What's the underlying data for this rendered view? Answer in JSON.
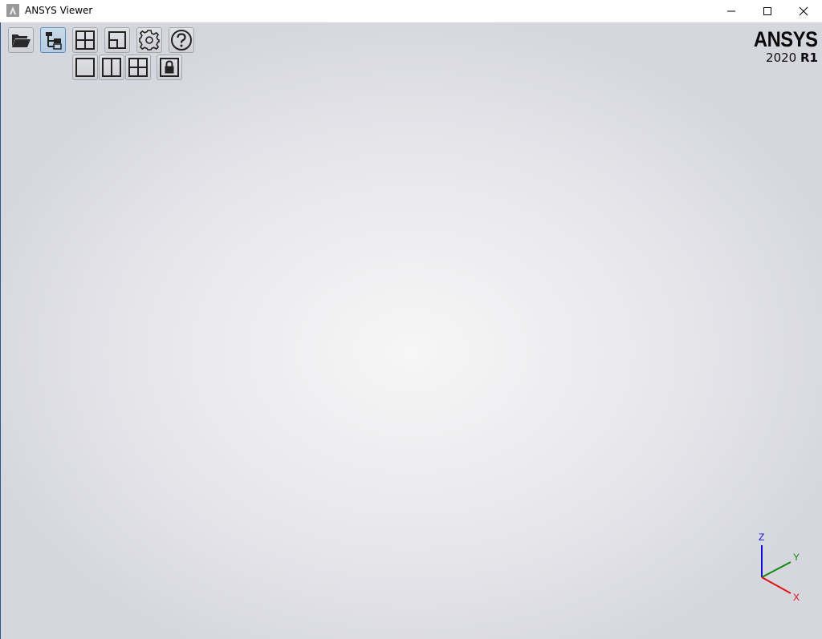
{
  "window": {
    "title": "ANSYS Viewer"
  },
  "toolbar": {
    "row1": [
      {
        "name": "open-file-button",
        "icon": "folder-open-icon"
      },
      {
        "name": "model-tree-button",
        "icon": "tree-icon",
        "active": true
      },
      {
        "name": "viewports-button",
        "icon": "quad-grid-icon"
      },
      {
        "name": "viewport-resize-button",
        "icon": "viewport-corner-icon"
      },
      {
        "name": "settings-button",
        "icon": "gear-icon"
      },
      {
        "name": "help-button",
        "icon": "help-icon"
      }
    ],
    "row2": [
      {
        "name": "single-viewport-button",
        "icon": "single-pane-icon"
      },
      {
        "name": "two-viewports-button",
        "icon": "split-vertical-icon"
      },
      {
        "name": "four-viewports-button",
        "icon": "quad-grid-icon"
      },
      {
        "name": "lock-viewports-button",
        "icon": "lock-icon"
      }
    ]
  },
  "logo": {
    "word": "ANSYS",
    "year": "2020",
    "release": "R1"
  },
  "triad": {
    "x_label": "X",
    "y_label": "Y",
    "z_label": "Z",
    "x_color": "#e01010",
    "y_color": "#108a10",
    "z_color": "#1010d8"
  },
  "colors": {
    "active_button": "#5a90c2",
    "viewport_center": "#f6f6f6",
    "viewport_edge": "#d6d7de"
  }
}
